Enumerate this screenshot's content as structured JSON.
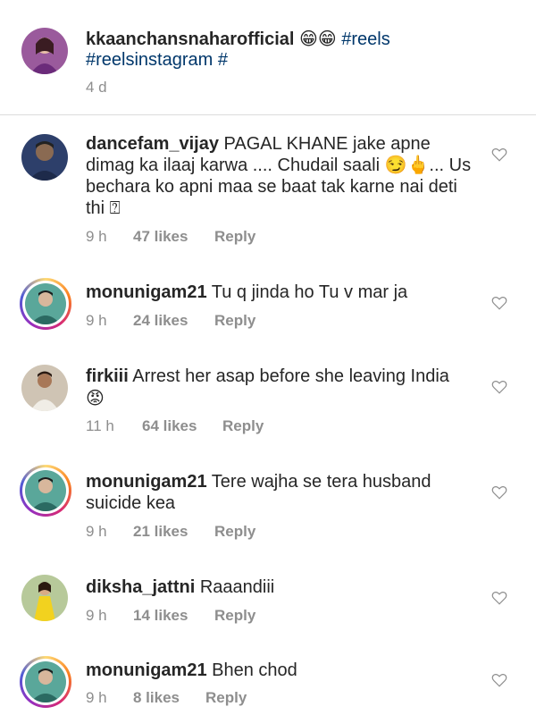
{
  "caption": {
    "username": "kkaanchansnaharofficial",
    "emojis": "😁😁",
    "line1_tags": "#reels",
    "line2_tags": "#reelsinstagram #",
    "time": "4 d"
  },
  "comments": [
    {
      "username": "dancefam_vijay",
      "text_line1": "PAGAL KHANE jake apne",
      "text_line2": "dimag ka ilaaj karwa .... Chudail saali 😏🖕... Us",
      "text_line3": "bechara ko apni maa se baat tak karne nai deti",
      "text_line4": "thi ⍰",
      "time": "9 h",
      "likes": "47 likes",
      "reply": "Reply"
    },
    {
      "username": "monunigam21",
      "text_line1": "Tu q jinda ho Tu v mar ja",
      "time": "9 h",
      "likes": "24 likes",
      "reply": "Reply"
    },
    {
      "username": "firkiii",
      "text_line1": "Arrest her asap before she leaving India",
      "text_line2": "😡",
      "time": "11 h",
      "likes": "64 likes",
      "reply": "Reply"
    },
    {
      "username": "monunigam21",
      "text_line1": "Tere wajha se tera husband",
      "text_line2": "suicide kea",
      "time": "9 h",
      "likes": "21 likes",
      "reply": "Reply"
    },
    {
      "username": "diksha_jattni",
      "text_line1": "Raaandiii",
      "time": "9 h",
      "likes": "14 likes",
      "reply": "Reply"
    },
    {
      "username": "monunigam21",
      "text_line1": "Bhen chod",
      "time": "9 h",
      "likes": "8 likes",
      "reply": "Reply"
    }
  ],
  "colors": {
    "text": "#262626",
    "muted": "#8e8e8e",
    "hashtag": "#00376b",
    "divider": "#dbdbdb"
  },
  "icons": {
    "like": "heart-outline-icon"
  }
}
